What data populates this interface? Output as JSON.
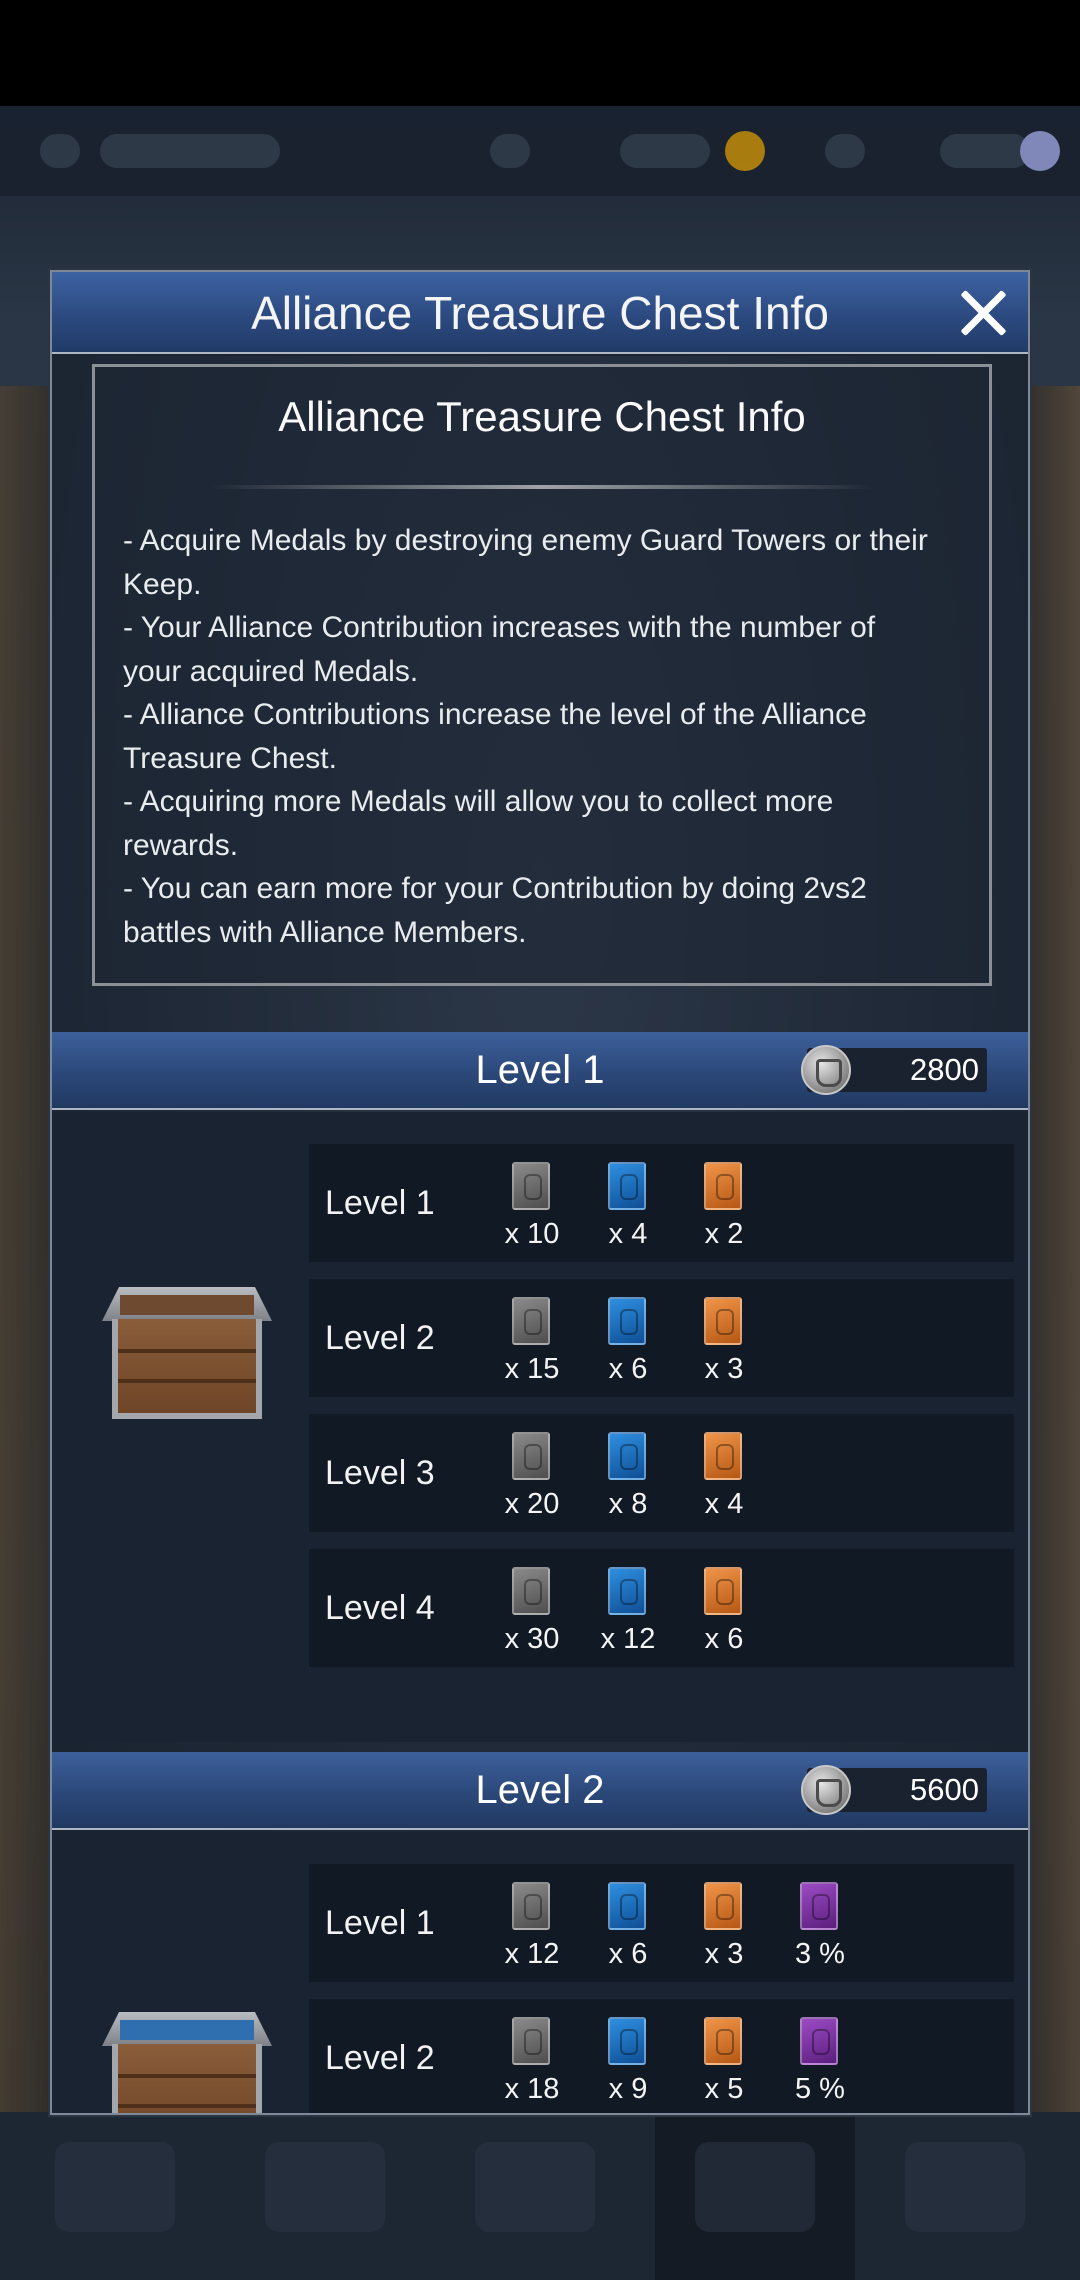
{
  "dialog": {
    "title": "Alliance Treasure Chest Info",
    "close_icon": "close-icon"
  },
  "info": {
    "title": "Alliance Treasure Chest Info",
    "lines": [
      "- Acquire Medals by destroying enemy Guard Towers or their",
      "Keep.",
      "- Your Alliance Contribution increases with the number of",
      "your acquired Medals.",
      "- Alliance Contributions increase the level of the Alliance",
      "Treasure Chest.",
      "- Acquiring more Medals will allow you to collect more",
      "rewards.",
      "- You can earn more for your Contribution by doing 2vs2",
      "battles with Alliance Members."
    ]
  },
  "levels": [
    {
      "title": "Level 1",
      "medals": "2800",
      "rows": [
        {
          "label": "Level 1",
          "rewards": [
            {
              "color": "gray",
              "qty": "x 10"
            },
            {
              "color": "blue",
              "qty": "x 4"
            },
            {
              "color": "orange",
              "qty": "x 2"
            }
          ]
        },
        {
          "label": "Level 2",
          "rewards": [
            {
              "color": "gray",
              "qty": "x 15"
            },
            {
              "color": "blue",
              "qty": "x 6"
            },
            {
              "color": "orange",
              "qty": "x 3"
            }
          ]
        },
        {
          "label": "Level 3",
          "rewards": [
            {
              "color": "gray",
              "qty": "x 20"
            },
            {
              "color": "blue",
              "qty": "x 8"
            },
            {
              "color": "orange",
              "qty": "x 4"
            }
          ]
        },
        {
          "label": "Level 4",
          "rewards": [
            {
              "color": "gray",
              "qty": "x 30"
            },
            {
              "color": "blue",
              "qty": "x 12"
            },
            {
              "color": "orange",
              "qty": "x 6"
            }
          ]
        }
      ]
    },
    {
      "title": "Level 2",
      "medals": "5600",
      "rows": [
        {
          "label": "Level 1",
          "rewards": [
            {
              "color": "gray",
              "qty": "x 12"
            },
            {
              "color": "blue",
              "qty": "x 6"
            },
            {
              "color": "orange",
              "qty": "x 3"
            },
            {
              "color": "purple",
              "qty": "3 %"
            }
          ]
        },
        {
          "label": "Level 2",
          "rewards": [
            {
              "color": "gray",
              "qty": "x 18"
            },
            {
              "color": "blue",
              "qty": "x 9"
            },
            {
              "color": "orange",
              "qty": "x 5"
            },
            {
              "color": "purple",
              "qty": "5 %"
            }
          ]
        }
      ]
    }
  ],
  "colors": {
    "header_blue": "#2c4a80",
    "card_gray": "#6b6b6b",
    "card_blue": "#1a6fc4",
    "card_orange": "#d9762f",
    "card_purple": "#7a3aa3"
  }
}
